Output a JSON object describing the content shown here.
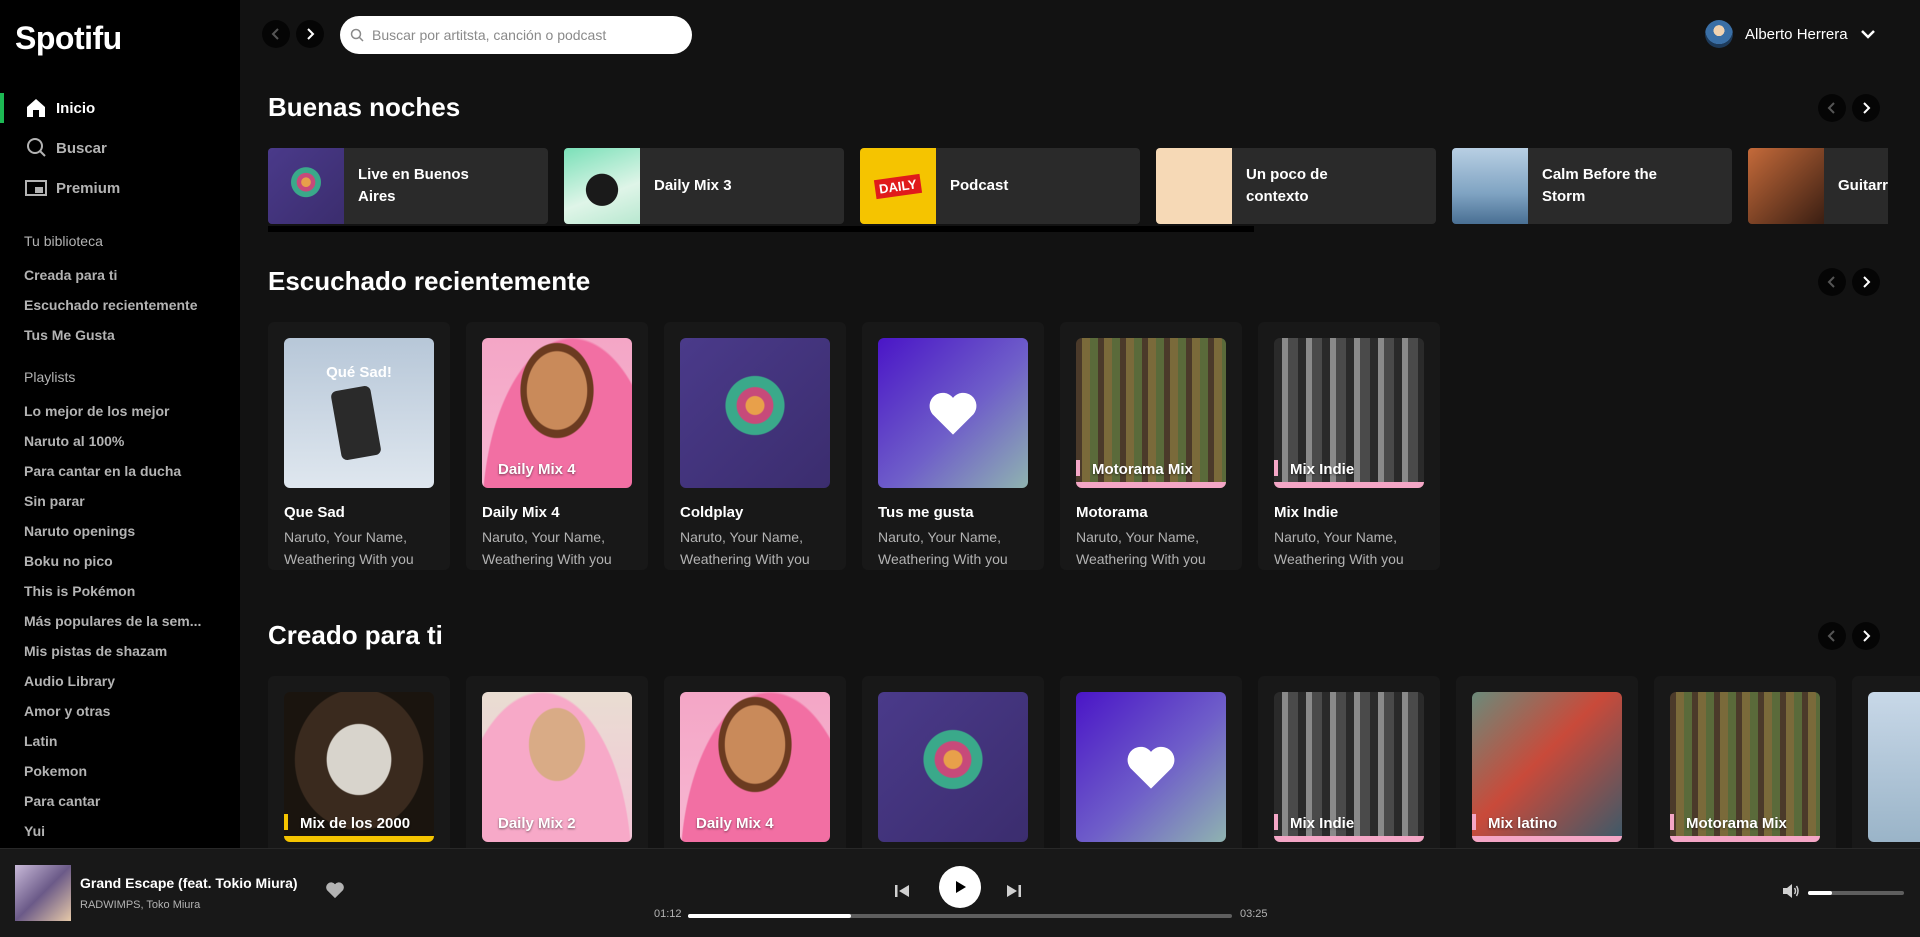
{
  "app": {
    "logo": "Spotifu"
  },
  "sidebar": {
    "nav": [
      {
        "label": "Inicio",
        "icon": "home-icon",
        "active": true
      },
      {
        "label": "Buscar",
        "icon": "search-icon",
        "active": false
      },
      {
        "label": "Premium",
        "icon": "premium-icon",
        "active": false
      }
    ],
    "library_label": "Tu biblioteca",
    "library": [
      "Creada para ti",
      "Escuchado recientemente",
      "Tus Me Gusta"
    ],
    "playlists_label": "Playlists",
    "playlists": [
      "Lo mejor de los mejor",
      "Naruto al 100%",
      "Para cantar en la ducha",
      "Sin parar",
      "Naruto openings",
      "Boku no pico",
      "This is Pokémon",
      "Más populares de la sem...",
      "Mis pistas de shazam",
      "Audio Library",
      "Amor y otras",
      "Latin",
      "Pokemon",
      "Para cantar",
      "Yui"
    ]
  },
  "topbar": {
    "search_placeholder": "Buscar por artitsta, canción o podcast",
    "user_name": "Alberto Herrera"
  },
  "sections": {
    "good_night": {
      "title": "Buenas noches",
      "items": [
        "Live en Buenos Aires",
        "Daily Mix 3",
        "Podcast",
        "Un poco de contexto",
        "Calm Before the Storm",
        "Guitarra"
      ]
    },
    "recent": {
      "title": "Escuchado recientemente",
      "cards": [
        {
          "title": "Que Sad",
          "subtitle": "Naruto, Your Name, Weathering With you",
          "cover_text": "Qué Sad!"
        },
        {
          "title": "Daily Mix 4",
          "subtitle": "Naruto, Your Name, Weathering With you",
          "cover_text": "Daily Mix 4"
        },
        {
          "title": "Coldplay",
          "subtitle": "Naruto, Your Name, Weathering With you",
          "cover_text": ""
        },
        {
          "title": "Tus me gusta",
          "subtitle": "Naruto, Your Name, Weathering With you",
          "cover_text": ""
        },
        {
          "title": "Motorama",
          "subtitle": "Naruto, Your Name, Weathering With you",
          "cover_text": "Motorama Mix"
        },
        {
          "title": "Mix Indie",
          "subtitle": "Naruto, Your Name, Weathering With you",
          "cover_text": "Mix Indie"
        }
      ]
    },
    "made_for_you": {
      "title": "Creado para ti",
      "cards": [
        {
          "cover_text": "Mix de los 2000"
        },
        {
          "cover_text": "Daily Mix 2"
        },
        {
          "cover_text": "Daily Mix 4"
        },
        {
          "cover_text": ""
        },
        {
          "cover_text": ""
        },
        {
          "cover_text": "Mix Indie"
        },
        {
          "cover_text": "Mix latino"
        },
        {
          "cover_text": "Motorama Mix"
        }
      ]
    }
  },
  "player": {
    "title": "Grand Escape (feat. Tokio Miura)",
    "artist": "RADWIMPS, Toko Miura",
    "current_time": "01:12",
    "total_time": "03:25",
    "progress": 0.3,
    "volume": 0.25
  },
  "colors": {
    "accent": "#1db954",
    "background": "#121212",
    "card": "#181818"
  }
}
